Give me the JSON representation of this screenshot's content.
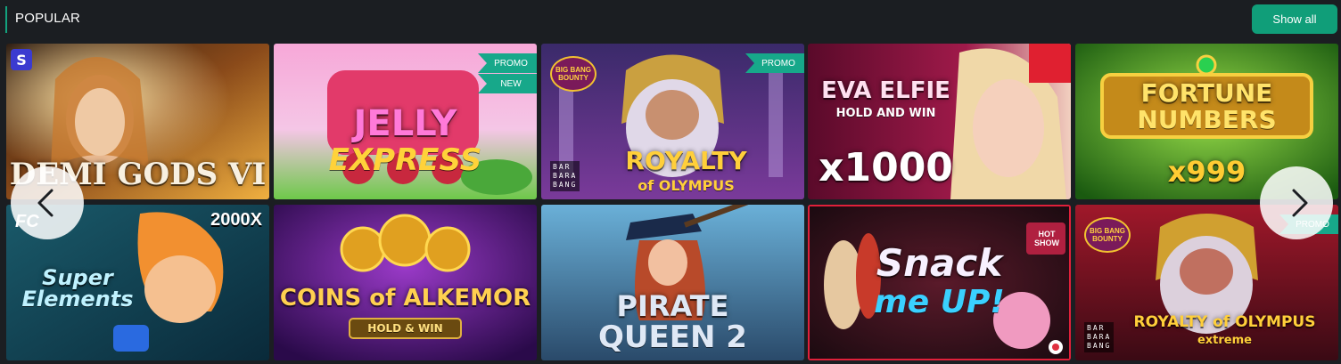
{
  "section": {
    "title": "POPULAR",
    "show_all_label": "Show all"
  },
  "colors": {
    "accent": "#13a27e",
    "button": "#109e79",
    "background": "#1b1e22",
    "ribbon": "#17a88a"
  },
  "games": [
    {
      "title": "DEMI GODS VI",
      "badges": [],
      "icon": "provider-s-logo-icon"
    },
    {
      "title": "JELLY",
      "subtitle": "EXPRESS",
      "badges": [
        "PROMO",
        "NEW"
      ]
    },
    {
      "title": "ROYALTY",
      "subtitle": "of OLYMPUS",
      "badges": [
        "PROMO"
      ],
      "logo": "BIG BANG BOUNTY",
      "provider": [
        "BAR",
        "BARA",
        "BANG"
      ]
    },
    {
      "title": "EVA ELFIE",
      "subtitle": "HOLD AND WIN",
      "extra": "x1000",
      "badges": []
    },
    {
      "title": "FORTUNE",
      "subtitle": "NUMBERS",
      "extra": "x999",
      "badges": []
    },
    {
      "title": "Super",
      "subtitle": "Elements",
      "extra": "2000X",
      "logo": "FC",
      "badges": []
    },
    {
      "title": "COINS of ALKEMOR",
      "subtitle": "HOLD & WIN",
      "badges": []
    },
    {
      "title": "PIRATE",
      "subtitle": "QUEEN 2",
      "badges": []
    },
    {
      "title": "Snack",
      "subtitle": "me UP!",
      "extra": "HOT SHOW",
      "badges": []
    },
    {
      "title": "ROYALTY of OLYMPUS",
      "subtitle": "extreme",
      "badges": [
        "PROMO"
      ],
      "logo": "BIG BANG BOUNTY",
      "provider": [
        "BAR",
        "BARA",
        "BANG"
      ]
    }
  ]
}
